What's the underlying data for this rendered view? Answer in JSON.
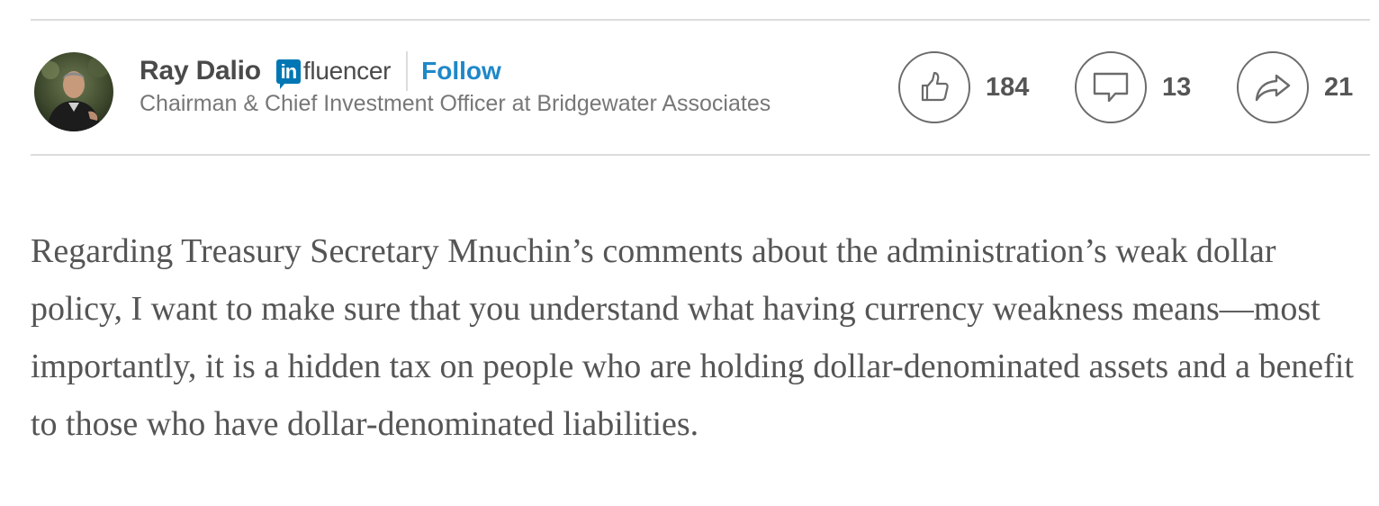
{
  "author": {
    "name": "Ray Dalio",
    "badge_prefix": "in",
    "badge_text": "fluencer",
    "follow_label": "Follow",
    "headline": "Chairman & Chief Investment Officer at Bridgewater Associates"
  },
  "actions": {
    "likes": {
      "icon": "thumbs-up-icon",
      "count": "184"
    },
    "comments": {
      "icon": "comment-icon",
      "count": "13"
    },
    "shares": {
      "icon": "share-arrow-icon",
      "count": "21"
    }
  },
  "article": {
    "paragraph": "Regarding Treasury Secretary Mnuchin’s comments about the administration’s weak dollar policy, I want to make sure that you understand what having currency weakness means—most importantly, it is a hidden tax on people who are holding dollar-denominated assets and a benefit to those who have dollar-denominated liabilities."
  },
  "colors": {
    "brand_blue": "#0077b5",
    "follow_blue": "#1e88c8",
    "text_dark": "#4a4a4a",
    "text_muted": "#777777",
    "rule": "#dcdcdc"
  }
}
